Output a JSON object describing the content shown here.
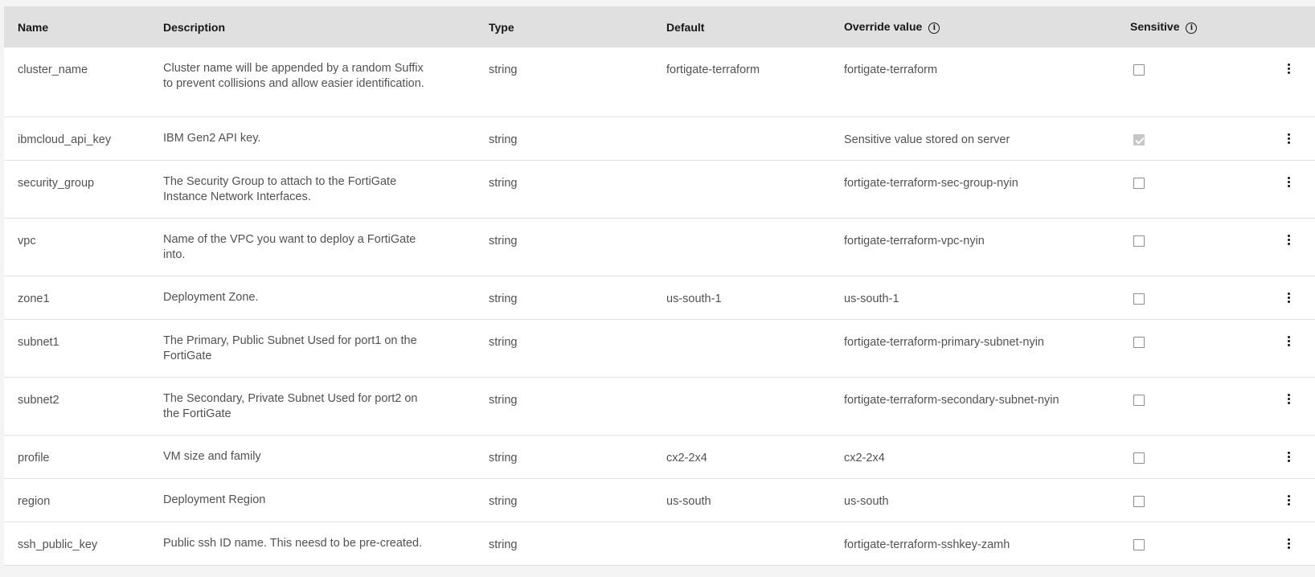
{
  "headers": {
    "name": "Name",
    "description": "Description",
    "type": "Type",
    "default": "Default",
    "override": "Override value",
    "sensitive": "Sensitive"
  },
  "rows": [
    {
      "name": "cluster_name",
      "description": "Cluster name will be appended by a random Suffix to prevent collisions and allow easier identification.",
      "type": "string",
      "default": "fortigate-terraform",
      "override": "fortigate-terraform",
      "sensitive": false
    },
    {
      "name": "ibmcloud_api_key",
      "description": "IBM Gen2 API key.",
      "type": "string",
      "default": "",
      "override": "Sensitive value stored on server",
      "sensitive": true
    },
    {
      "name": "security_group",
      "description": "The Security Group to attach to the FortiGate Instance Network Interfaces.",
      "type": "string",
      "default": "",
      "override": "fortigate-terraform-sec-group-nyin",
      "sensitive": false
    },
    {
      "name": "vpc",
      "description": "Name of the VPC you want to deploy a FortiGate into.",
      "type": "string",
      "default": "",
      "override": "fortigate-terraform-vpc-nyin",
      "sensitive": false
    },
    {
      "name": "zone1",
      "description": "Deployment Zone.",
      "type": "string",
      "default": "us-south-1",
      "override": "us-south-1",
      "sensitive": false
    },
    {
      "name": "subnet1",
      "description": "The Primary, Public Subnet Used for port1 on the FortiGate",
      "type": "string",
      "default": "",
      "override": "fortigate-terraform-primary-subnet-nyin",
      "sensitive": false
    },
    {
      "name": "subnet2",
      "description": "The Secondary, Private Subnet Used for port2 on the FortiGate",
      "type": "string",
      "default": "",
      "override": "fortigate-terraform-secondary-subnet-nyin",
      "sensitive": false
    },
    {
      "name": "profile",
      "description": "VM size and family",
      "type": "string",
      "default": "cx2-2x4",
      "override": "cx2-2x4",
      "sensitive": false
    },
    {
      "name": "region",
      "description": "Deployment Region",
      "type": "string",
      "default": "us-south",
      "override": "us-south",
      "sensitive": false
    },
    {
      "name": "ssh_public_key",
      "description": "Public ssh ID name. This neesd to be pre-created.",
      "type": "string",
      "default": "",
      "override": "fortigate-terraform-sshkey-zamh",
      "sensitive": false
    }
  ],
  "icons": {
    "info": "info-icon",
    "row_menu": "overflow-menu-icon",
    "checkbox": "checkbox"
  }
}
